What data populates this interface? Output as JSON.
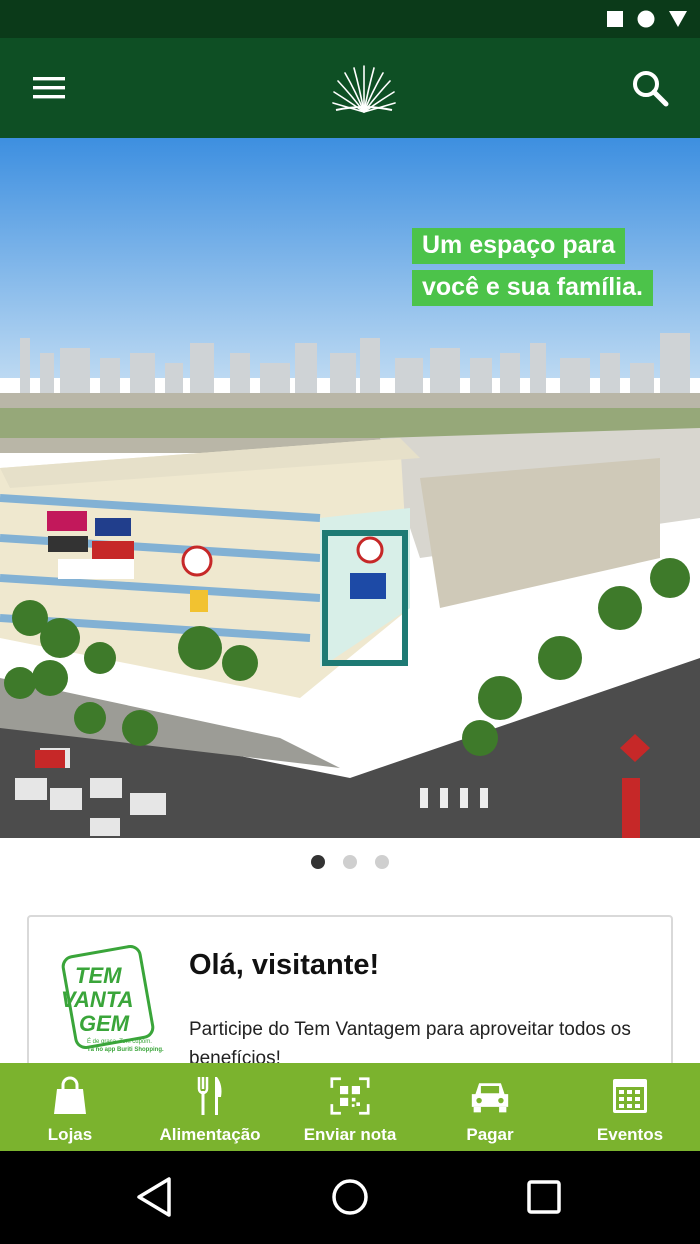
{
  "status_bar": {
    "icons": [
      "square-icon",
      "circle-icon",
      "triangle-down-icon"
    ]
  },
  "app_bar": {
    "icons": [
      "menu-icon",
      "palm-logo-icon",
      "search-icon"
    ]
  },
  "hero": {
    "tagline_line1": "Um espaço para",
    "tagline_line2": "você e sua família.",
    "tagline_color": "#4cc34a",
    "carousel_total": 3,
    "carousel_active": 1
  },
  "card": {
    "logo_text_1": "TEM",
    "logo_text_2": "VANTA",
    "logo_text_3": "GEM",
    "logo_small_1": "É de graça. Tem cupom.",
    "logo_small_2": "Tá no app Buriti Shopping.",
    "title": "Olá, visitante!",
    "text": "Participe do Tem Vantagem para aproveitar todos os benefícios!"
  },
  "bottom_nav": {
    "items": [
      {
        "label": "Lojas",
        "icon": "shopping-bag-icon"
      },
      {
        "label": "Alimentação",
        "icon": "fork-knife-icon"
      },
      {
        "label": "Enviar nota",
        "icon": "qr-scan-icon"
      },
      {
        "label": "Pagar",
        "icon": "car-icon"
      },
      {
        "label": "Eventos",
        "icon": "calendar-icon"
      }
    ],
    "background": "#7bb32e"
  },
  "colors": {
    "status_bar": "#0b3a19",
    "app_bar": "#0e4f24"
  }
}
